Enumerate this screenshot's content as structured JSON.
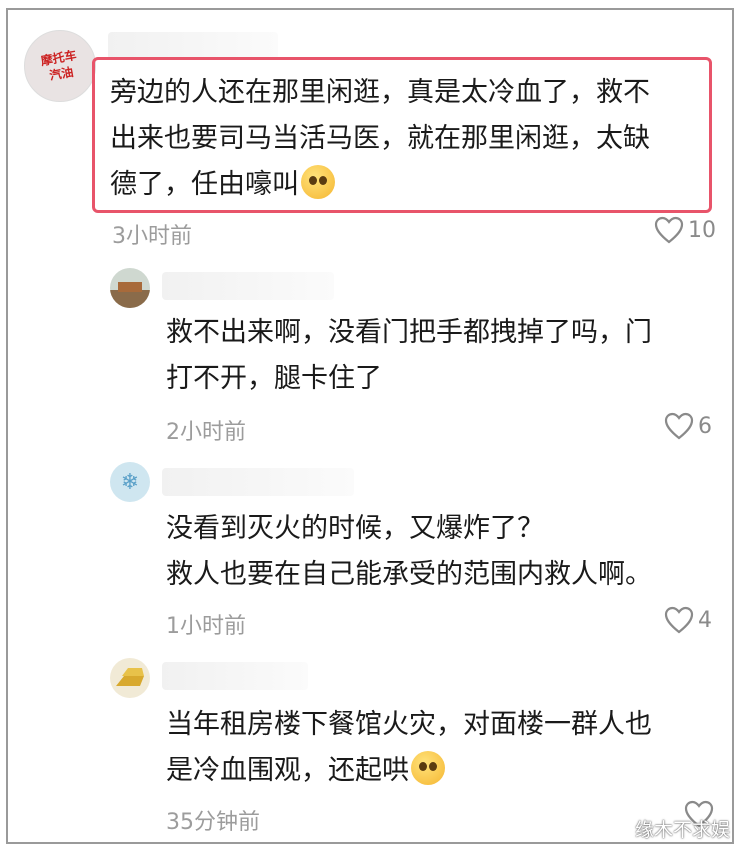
{
  "comments": [
    {
      "lines": [
        "旁边的人还在那里闲逛，真是太冷血了，救不",
        "出来也要司马当活马医，就在那里闲逛，太缺",
        "德了，任由嚎叫"
      ],
      "time": "3小时前",
      "likes": "10",
      "avatar_lines": [
        "摩托车",
        "汽油"
      ],
      "emoji": "frown-emoji"
    },
    {
      "lines": [
        "救不出来啊，没看门把手都拽掉了吗，门",
        "打不开，腿卡住了"
      ],
      "time": "2小时前",
      "likes": "6"
    },
    {
      "lines": [
        "没看到灭火的时候，又爆炸了？",
        "救人也要在自己能承受的范围内救人啊。"
      ],
      "time": "1小时前",
      "likes": "4"
    },
    {
      "lines": [
        "当年租房楼下餐馆火灾，对面楼一群人也",
        "是冷血围观，还起哄"
      ],
      "time": "35分钟前",
      "likes": "",
      "emoji": "blush-emoji"
    }
  ],
  "watermark": "缘木不求娱",
  "colors": {
    "highlight": "#e8546a",
    "meta": "#9c9c9c",
    "text": "#1a1a1a"
  }
}
